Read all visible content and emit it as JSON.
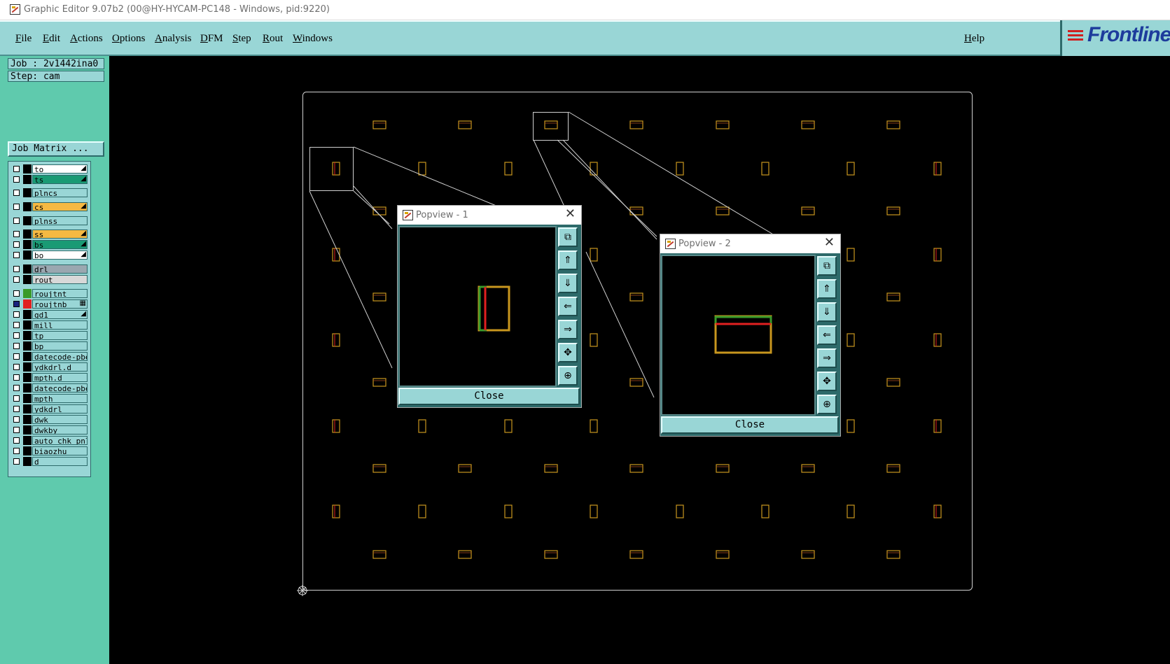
{
  "window": {
    "title": "Graphic Editor 9.07b2 (00@HY-HYCAM-PC148 - Windows, pid:9220)"
  },
  "menu": {
    "items": [
      "File",
      "Edit",
      "Actions",
      "Options",
      "Analysis",
      "DFM",
      "Step",
      "Rout",
      "Windows"
    ],
    "help": "Help"
  },
  "logo": {
    "text": "Frontline"
  },
  "job": {
    "job_line": "Job : 2v1442ina0",
    "step_line": "Step: cam",
    "matrix_button": "Job Matrix ..."
  },
  "layers": [
    {
      "name": "to",
      "color": "#ffffff",
      "checked": false,
      "mark": "◢"
    },
    {
      "name": "ts",
      "color": "#1a9a74",
      "checked": false,
      "mark": "◢"
    },
    {
      "name": "plncs",
      "color": "#99d6d6",
      "checked": false,
      "mark": ""
    },
    {
      "name": "cs",
      "color": "#f5b942",
      "checked": false,
      "mark": "◢"
    },
    {
      "name": "plnss",
      "color": "#99d6d6",
      "checked": false,
      "mark": ""
    },
    {
      "name": "ss",
      "color": "#f5b942",
      "checked": false,
      "mark": "◢"
    },
    {
      "name": "bs",
      "color": "#1a9a74",
      "checked": false,
      "mark": "◢"
    },
    {
      "name": "bo",
      "color": "#ffffff",
      "checked": false,
      "mark": "◢"
    },
    {
      "name": "drl",
      "color": "#9aa7b0",
      "checked": false,
      "mark": ""
    },
    {
      "name": "rout",
      "color": "#d8d8d8",
      "checked": false,
      "mark": ""
    },
    {
      "name": "roujtnt",
      "color": "#99d6d6",
      "checked": false,
      "mark": "",
      "swatch": "#3a9a2a"
    },
    {
      "name": "roujtnb",
      "color": "#99d6d6",
      "checked": true,
      "mark": "▦",
      "swatch": "#e02020"
    },
    {
      "name": "gd1",
      "color": "#99d6d6",
      "checked": false,
      "mark": "◢"
    },
    {
      "name": "mill",
      "color": "#99d6d6",
      "checked": false,
      "mark": ""
    },
    {
      "name": "tp",
      "color": "#99d6d6",
      "checked": false,
      "mark": ""
    },
    {
      "name": "bp",
      "color": "#99d6d6",
      "checked": false,
      "mark": ""
    },
    {
      "name": "datecode-pbe",
      "color": "#99d6d6",
      "checked": false,
      "mark": ""
    },
    {
      "name": "ydkdrl.d",
      "color": "#99d6d6",
      "checked": false,
      "mark": ""
    },
    {
      "name": "mpth.d",
      "color": "#99d6d6",
      "checked": false,
      "mark": ""
    },
    {
      "name": "datecode-pbe",
      "color": "#99d6d6",
      "checked": false,
      "mark": ""
    },
    {
      "name": "mpth",
      "color": "#99d6d6",
      "checked": false,
      "mark": ""
    },
    {
      "name": "ydkdrl",
      "color": "#99d6d6",
      "checked": false,
      "mark": ""
    },
    {
      "name": "dwk",
      "color": "#99d6d6",
      "checked": false,
      "mark": ""
    },
    {
      "name": "dwkby",
      "color": "#99d6d6",
      "checked": false,
      "mark": ""
    },
    {
      "name": "auto_chk_pnl",
      "color": "#99d6d6",
      "checked": false,
      "mark": ""
    },
    {
      "name": "biaozhu",
      "color": "#99d6d6",
      "checked": false,
      "mark": ""
    },
    {
      "name": "d",
      "color": "#99d6d6",
      "checked": false,
      "mark": ""
    }
  ],
  "popviews": [
    {
      "title": "Popview - 1",
      "close_label": "Close",
      "buttons": [
        "zoom-fit-icon",
        "pan-up-icon",
        "pan-down-icon",
        "pan-left-icon",
        "pan-right-icon",
        "zoom-in-icon",
        "zoom-out-icon"
      ]
    },
    {
      "title": "Popview - 2",
      "close_label": "Close",
      "buttons": [
        "zoom-fit-icon",
        "pan-up-icon",
        "pan-down-icon",
        "pan-left-icon",
        "pan-right-icon",
        "zoom-in-icon",
        "zoom-out-icon"
      ]
    }
  ],
  "colors": {
    "menu_bg": "#99d6d6",
    "panel_bg": "#5fcaad",
    "pad_outline": "#c8961e",
    "pad_green": "#3a9a2a",
    "pad_red": "#e02020"
  }
}
